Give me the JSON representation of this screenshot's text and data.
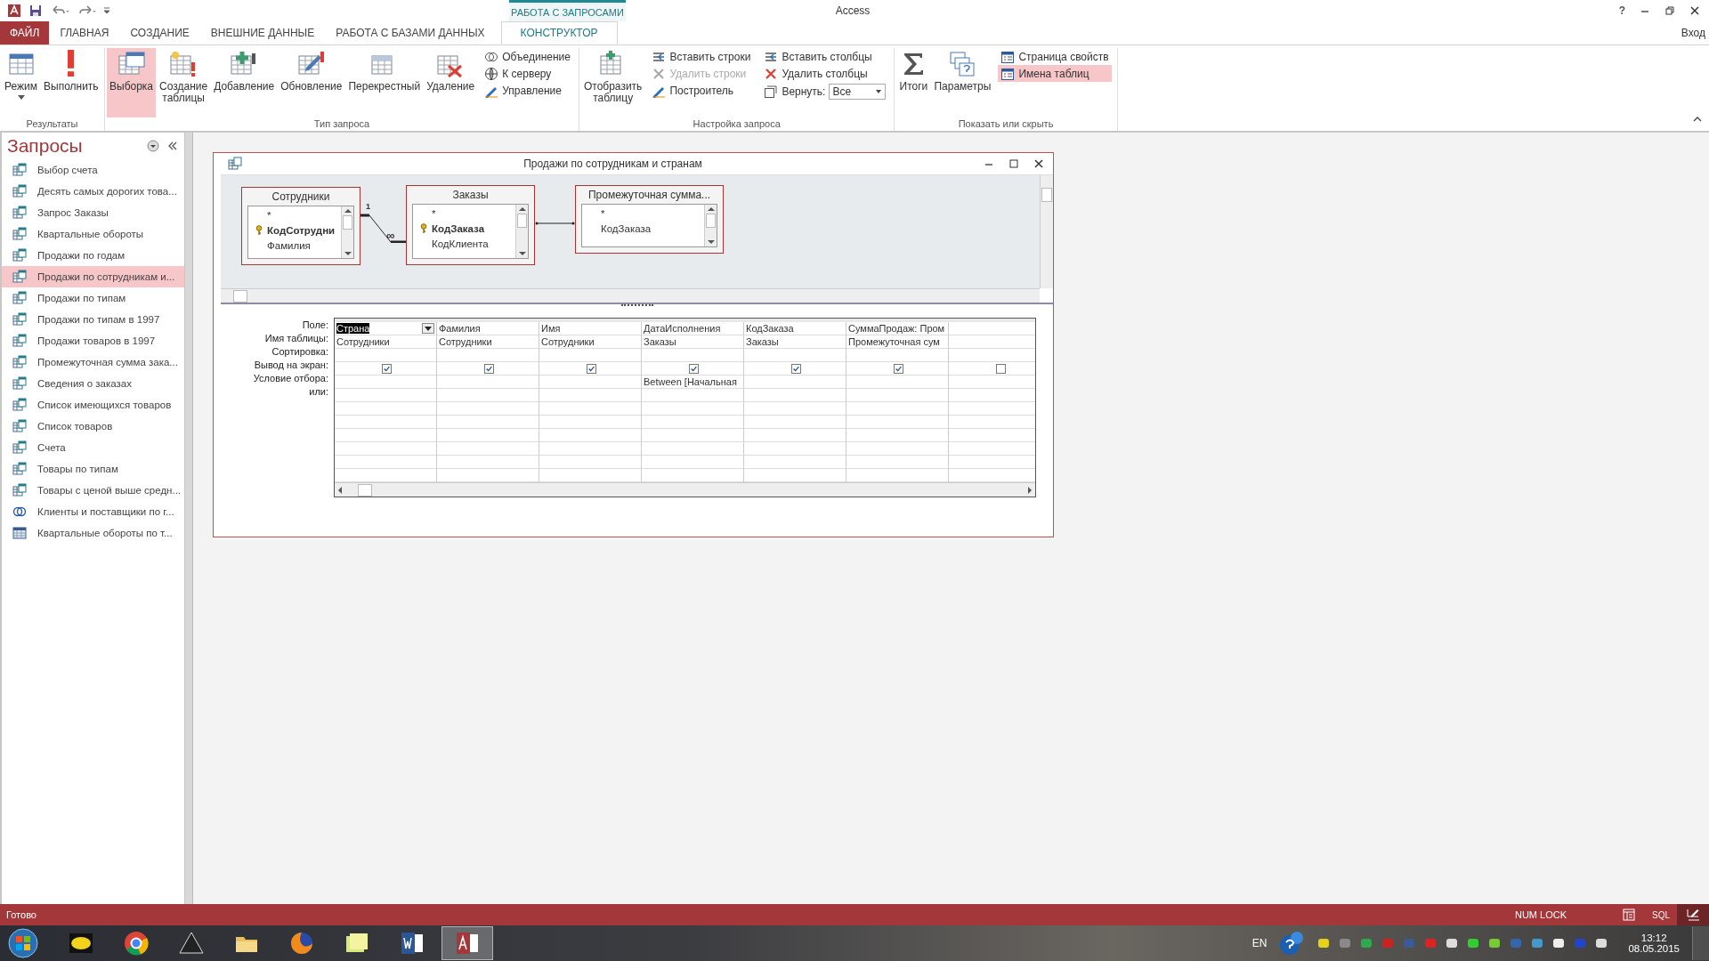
{
  "window": {
    "title": "Access",
    "help": "?",
    "sign_in": "Вход"
  },
  "context_group": "РАБОТА С ЗАПРОСАМИ",
  "tabs": [
    {
      "label": "ФАЙЛ",
      "kind": "file",
      "selected": false
    },
    {
      "label": "ГЛАВНАЯ",
      "kind": "tab",
      "selected": false
    },
    {
      "label": "СОЗДАНИЕ",
      "kind": "tab",
      "selected": false
    },
    {
      "label": "ВНЕШНИЕ ДАННЫЕ",
      "kind": "tab",
      "selected": false
    },
    {
      "label": "РАБОТА С БАЗАМИ ДАННЫХ",
      "kind": "tab",
      "selected": false
    },
    {
      "label": "КОНСТРУКТОР",
      "kind": "tab",
      "selected": true
    }
  ],
  "ribbon": [
    {
      "label": "Результаты",
      "items": [
        {
          "kind": "large",
          "label": "Режим",
          "dropdown": true,
          "selected": false
        },
        {
          "kind": "large",
          "label": "Выполнить",
          "dropdown": false,
          "selected": false
        }
      ]
    },
    {
      "label": "Тип запроса",
      "items": [
        {
          "kind": "large",
          "label": "Выборка",
          "dropdown": false,
          "selected": true
        },
        {
          "kind": "large",
          "label": "Создание таблицы",
          "dropdown": false,
          "selected": false
        },
        {
          "kind": "large",
          "label": "Добавление",
          "dropdown": false,
          "selected": false
        },
        {
          "kind": "large",
          "label": "Обновление",
          "dropdown": false,
          "selected": false
        },
        {
          "kind": "large",
          "label": "Перекрестный",
          "dropdown": false,
          "selected": false
        },
        {
          "kind": "large",
          "label": "Удаление",
          "dropdown": false,
          "selected": false
        },
        {
          "kind": "column",
          "items": [
            {
              "kind": "small",
              "label": "Объединение",
              "selected": false,
              "disabled": false
            },
            {
              "kind": "small",
              "label": "К серверу",
              "selected": false,
              "disabled": false
            },
            {
              "kind": "small",
              "label": "Управление",
              "selected": false,
              "disabled": false
            }
          ]
        }
      ]
    },
    {
      "label": "Настройка запроса",
      "items": [
        {
          "kind": "large",
          "label": "Отобразить таблицу",
          "dropdown": false,
          "selected": false
        },
        {
          "kind": "column",
          "items": [
            {
              "kind": "small",
              "label": "Вставить строки",
              "selected": false,
              "disabled": false
            },
            {
              "kind": "small",
              "label": "Удалить строки",
              "selected": false,
              "disabled": true
            },
            {
              "kind": "small",
              "label": "Построитель",
              "selected": false,
              "disabled": false
            }
          ]
        },
        {
          "kind": "column",
          "items": [
            {
              "kind": "small",
              "label": "Вставить столбцы",
              "selected": false,
              "disabled": false
            },
            {
              "kind": "small",
              "label": "Удалить столбцы",
              "selected": false,
              "disabled": false
            },
            {
              "kind": "combo",
              "label": "Вернуть:",
              "value": "Все"
            }
          ]
        }
      ]
    },
    {
      "label": "Показать или скрыть",
      "items": [
        {
          "kind": "large",
          "label": "Итоги",
          "dropdown": false,
          "selected": false
        },
        {
          "kind": "large",
          "label": "Параметры",
          "dropdown": false,
          "selected": false
        },
        {
          "kind": "column",
          "items": [
            {
              "kind": "small",
              "label": "Страница свойств",
              "selected": false,
              "disabled": false
            },
            {
              "kind": "small",
              "label": "Имена таблиц",
              "selected": true,
              "disabled": false
            }
          ]
        }
      ]
    }
  ],
  "sidebar": {
    "title": "Запросы",
    "items": [
      {
        "label": "Выбор счета",
        "kind": "select",
        "selected": false
      },
      {
        "label": "Десять самых дорогих това...",
        "kind": "select",
        "selected": false
      },
      {
        "label": "Запрос Заказы",
        "kind": "select",
        "selected": false
      },
      {
        "label": "Квартальные обороты",
        "kind": "select",
        "selected": false
      },
      {
        "label": "Продажи по годам",
        "kind": "select",
        "selected": false
      },
      {
        "label": "Продажи по сотрудникам и...",
        "kind": "select",
        "selected": true
      },
      {
        "label": "Продажи по типам",
        "kind": "select",
        "selected": false
      },
      {
        "label": "Продажи по типам в 1997",
        "kind": "select",
        "selected": false
      },
      {
        "label": "Продажи товаров в 1997",
        "kind": "select",
        "selected": false
      },
      {
        "label": "Промежуточная сумма зака...",
        "kind": "select",
        "selected": false
      },
      {
        "label": "Сведения о заказах",
        "kind": "select",
        "selected": false
      },
      {
        "label": "Список имеющихся товаров",
        "kind": "select",
        "selected": false
      },
      {
        "label": "Список товаров",
        "kind": "select",
        "selected": false
      },
      {
        "label": "Счета",
        "kind": "select",
        "selected": false
      },
      {
        "label": "Товары по типам",
        "kind": "select",
        "selected": false
      },
      {
        "label": "Товары с ценой выше средн...",
        "kind": "select",
        "selected": false
      },
      {
        "label": "Клиенты и поставщики по г...",
        "kind": "union",
        "selected": false
      },
      {
        "label": "Квартальные обороты по т...",
        "kind": "crosstab",
        "selected": false
      }
    ]
  },
  "query_window": {
    "title": "Продажи по сотрудникам и странам",
    "tables": [
      {
        "name": "Сотрудники",
        "fields": [
          {
            "name": "*",
            "key": false
          },
          {
            "name": "КодСотрудни",
            "key": true
          },
          {
            "name": "Фамилия",
            "key": false
          }
        ]
      },
      {
        "name": "Заказы",
        "fields": [
          {
            "name": "*",
            "key": false
          },
          {
            "name": "КодЗаказа",
            "key": true
          },
          {
            "name": "КодКлиента",
            "key": false
          }
        ]
      },
      {
        "name": "Промежуточная сумма...",
        "fields": [
          {
            "name": "*",
            "key": false
          },
          {
            "name": "КодЗаказа",
            "key": false
          }
        ]
      }
    ],
    "join": {
      "one": "1",
      "many": "∞"
    },
    "row_labels": [
      "Поле:",
      "Имя таблицы:",
      "Сортировка:",
      "Вывод на экран:",
      "Условие отбора:",
      "или:"
    ],
    "columns": [
      {
        "field": "Страна",
        "table": "Сотрудники",
        "show": true,
        "selected": true
      },
      {
        "field": "Фамилия",
        "table": "Сотрудники",
        "show": true,
        "selected": false
      },
      {
        "field": "Имя",
        "table": "Сотрудники",
        "show": true,
        "selected": false
      },
      {
        "field": "ДатаИсполнения",
        "table": "Заказы",
        "show": true,
        "criteria": "Between [Начальная",
        "selected": false
      },
      {
        "field": "КодЗаказа",
        "table": "Заказы",
        "show": true,
        "selected": false
      },
      {
        "field": "СуммаПродаж: Пром",
        "table": "Промежуточная сум",
        "show": true,
        "selected": false
      },
      {
        "show": false
      }
    ]
  },
  "status_bar": {
    "text": "Готово",
    "num_lock": "NUM LOCK",
    "views": [
      {
        "kind": "datasheet",
        "selected": false
      },
      {
        "kind": "sql",
        "label": "SQL",
        "selected": false
      },
      {
        "kind": "design",
        "selected": true
      }
    ]
  },
  "taskbar": {
    "apps": [
      {
        "kind": "badge",
        "selected": false
      },
      {
        "kind": "browser",
        "selected": false
      },
      {
        "kind": "triangle",
        "selected": false
      },
      {
        "kind": "folder",
        "selected": false
      },
      {
        "kind": "globe",
        "selected": false
      },
      {
        "kind": "notes",
        "selected": false
      },
      {
        "kind": "word",
        "selected": false
      },
      {
        "kind": "access",
        "selected": true
      }
    ],
    "language": "EN",
    "time": "13:12",
    "date": "08.05.2015"
  }
}
